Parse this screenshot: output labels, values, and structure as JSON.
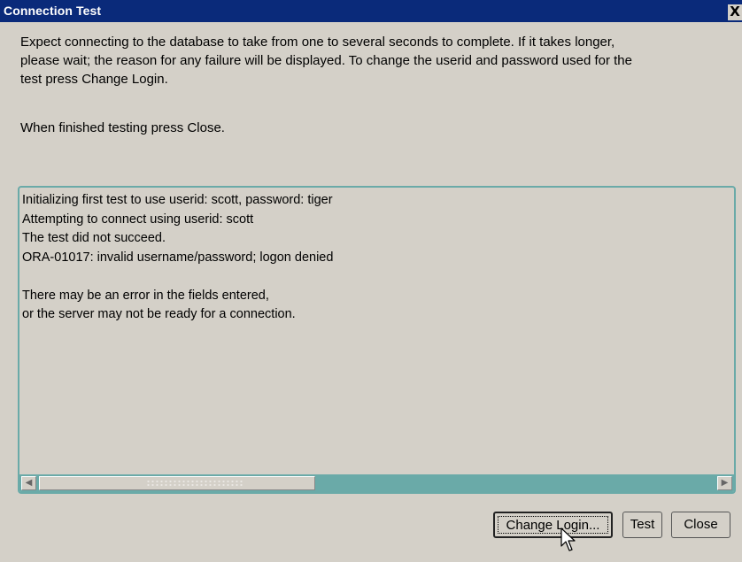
{
  "window": {
    "title": "Connection Test",
    "close_glyph": "X"
  },
  "instructions": {
    "paragraph1": "Expect connecting to the database to take from one to several seconds to complete. If it takes longer,\nplease wait; the reason for any failure will be displayed. To change the userid and password used for the\ntest press Change Login.",
    "paragraph2": "When finished testing press Close."
  },
  "log": {
    "text": "Initializing first test to use userid: scott, password: tiger\nAttempting to connect using userid:  scott\nThe test did not succeed.\nORA-01017: invalid username/password; logon denied\n\nThere may be an error in the fields entered,\nor the server may not be ready for a connection."
  },
  "scrollbar": {
    "left_glyph": "◀",
    "right_glyph": "▶"
  },
  "buttons": {
    "change_login": "Change Login...",
    "test": "Test",
    "close": "Close"
  },
  "colors": {
    "titlebar": "#0a2a7a",
    "panel_border": "#6aaaa8",
    "background": "#d4d0c8"
  }
}
